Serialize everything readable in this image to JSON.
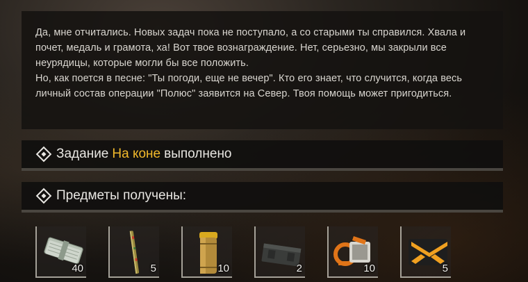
{
  "dialog": {
    "paragraphs": [
      "Да, мне отчитались. Новых задач пока не поступало, а со старыми ты справился. Хвала и почет, медаль и грамота, ха! Вот твое вознаграждение. Нет, серьезно, мы закрыли все неурядицы, которые могли бы все положить.",
      "Но, как поется в песне: \"Ты погоди, еще не вечер\". Кто его знает, что случится, когда весь личный состав операции \"Полюс\" заявится на Север. Твоя помощь может пригодиться."
    ]
  },
  "quest_banner": {
    "prefix": "Задание",
    "quest_name": "На коне",
    "suffix": "выполнено",
    "icon": "diamond-icon",
    "highlight_color": "#f2b92b"
  },
  "items_banner": {
    "label": "Предметы получены:",
    "icon": "diamond-icon"
  },
  "rewards": [
    {
      "icon": "money-bundle-icon",
      "count": "40"
    },
    {
      "icon": "rod-icon",
      "count": "5"
    },
    {
      "icon": "canister-icon",
      "count": "10"
    },
    {
      "icon": "ammo-box-icon",
      "count": "2"
    },
    {
      "icon": "orange-device-icon",
      "count": "10"
    },
    {
      "icon": "orange-crate-icon",
      "count": "5"
    }
  ]
}
